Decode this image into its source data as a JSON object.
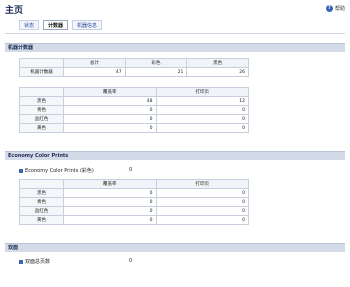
{
  "header": {
    "title": "主页",
    "help_label": "帮助",
    "help_icon": "help-icon"
  },
  "tabs": [
    {
      "label": "状态",
      "active": false
    },
    {
      "label": "计数器",
      "active": true
    },
    {
      "label": "机器信息",
      "active": false
    }
  ],
  "machine_counter": {
    "section_title": "机器计数器",
    "totals": {
      "headers": [
        "总计",
        "彩色",
        "黑色"
      ],
      "row_label": "机器计数器",
      "values": [
        "47",
        "21",
        "26"
      ]
    },
    "coverage": {
      "headers": [
        "覆盖率",
        "打印页"
      ],
      "rows": [
        {
          "label": "黑色",
          "coverage": "48",
          "pages": "12"
        },
        {
          "label": "青色",
          "coverage": "0",
          "pages": "0"
        },
        {
          "label": "品红色",
          "coverage": "0",
          "pages": "0"
        },
        {
          "label": "黄色",
          "coverage": "0",
          "pages": "0"
        }
      ]
    }
  },
  "economy": {
    "section_title": "Economy Color Prints",
    "item_label": "Economy Color Prints (彩色)",
    "item_value": "0",
    "coverage": {
      "headers": [
        "覆盖率",
        "打印页"
      ],
      "rows": [
        {
          "label": "黑色",
          "coverage": "0",
          "pages": "0"
        },
        {
          "label": "青色",
          "coverage": "0",
          "pages": "0"
        },
        {
          "label": "品红色",
          "coverage": "0",
          "pages": "0"
        },
        {
          "label": "黄色",
          "coverage": "0",
          "pages": "0"
        }
      ]
    }
  },
  "scan": {
    "section_title": "双面",
    "item_label": "双面总页数",
    "item_value": "0"
  }
}
